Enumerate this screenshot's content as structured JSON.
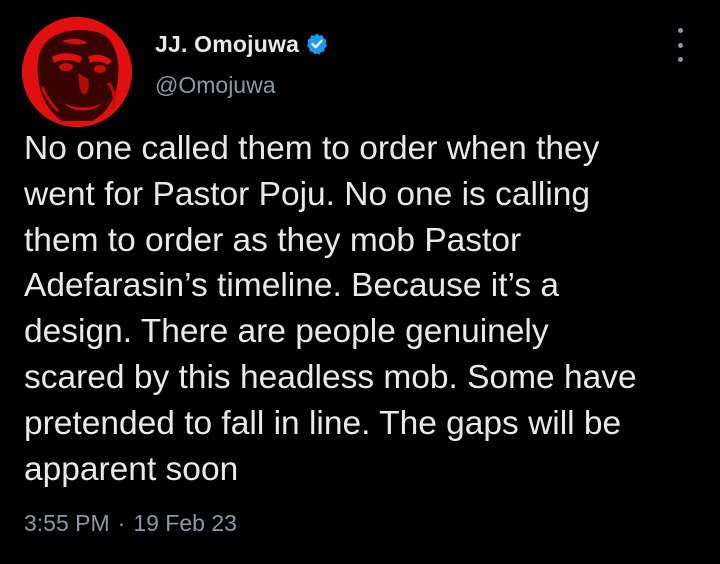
{
  "author": {
    "name": "JJ. Omojuwa",
    "handle": "@Omojuwa",
    "verified_icon": "verified-badge-icon",
    "avatar": "profile-photo"
  },
  "menu_icon": "more-options-icon",
  "tweet": {
    "text": "No one called them to order when they\nwent for Pastor Poju. No one is calling\nthem to order as they mob Pastor\nAdefarasin’s timeline. Because it’s a\ndesign. There are people genuinely\nscared by this headless mob. Some have\npretended to fall in line. The gaps will be\napparent soon",
    "time": "3:55 PM",
    "separator": "·",
    "date": "19 Feb 23"
  },
  "colors": {
    "background": "#000000",
    "text_primary": "#e7e9ea",
    "text_secondary": "#8b98a5",
    "verified_blue": "#1d9bf0",
    "avatar_red": "#e01010"
  }
}
